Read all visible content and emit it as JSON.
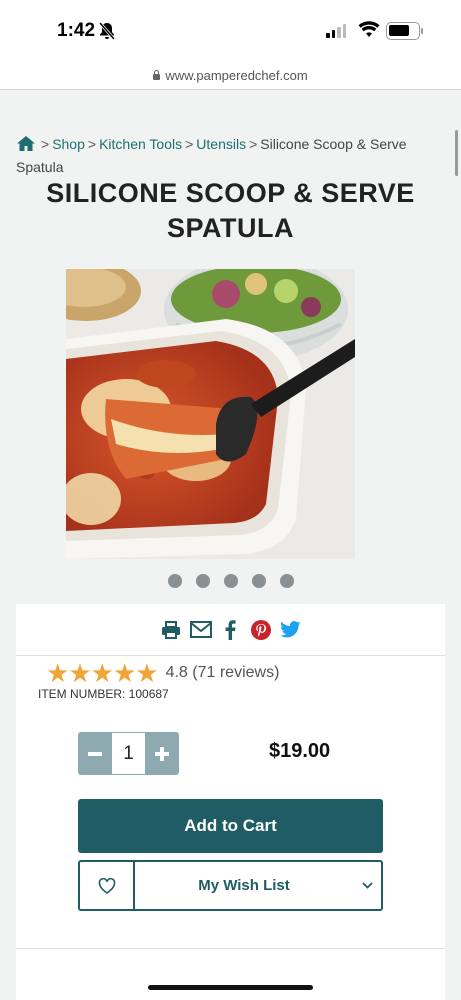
{
  "status_bar": {
    "time": "1:42"
  },
  "browser": {
    "url": "www.pamperedchef.com"
  },
  "breadcrumb": {
    "items": [
      "Shop",
      "Kitchen Tools",
      "Utensils"
    ],
    "current": "Silicone Scoop & Serve Spatula",
    "separator": ">"
  },
  "product": {
    "title": "SILICONE SCOOP & SERVE SPATULA",
    "rating_value": "4.8",
    "rating_stars": 5,
    "reviews": "(71 reviews)",
    "item_number": "ITEM NUMBER: 100687",
    "quantity": "1",
    "price": "$19.00",
    "add_to_cart": "Add to Cart",
    "wish_list": "My Wish List",
    "image_count": 5
  },
  "colors": {
    "primary": "#1f5c63",
    "link": "#1f6e72",
    "star": "#f0a43a",
    "pinterest": "#c8232c",
    "twitter": "#1da1f2"
  },
  "icons": [
    "home-icon",
    "print-icon",
    "email-icon",
    "facebook-icon",
    "pinterest-icon",
    "twitter-icon",
    "heart-icon",
    "chevron-down-icon",
    "minus-icon",
    "plus-icon"
  ]
}
